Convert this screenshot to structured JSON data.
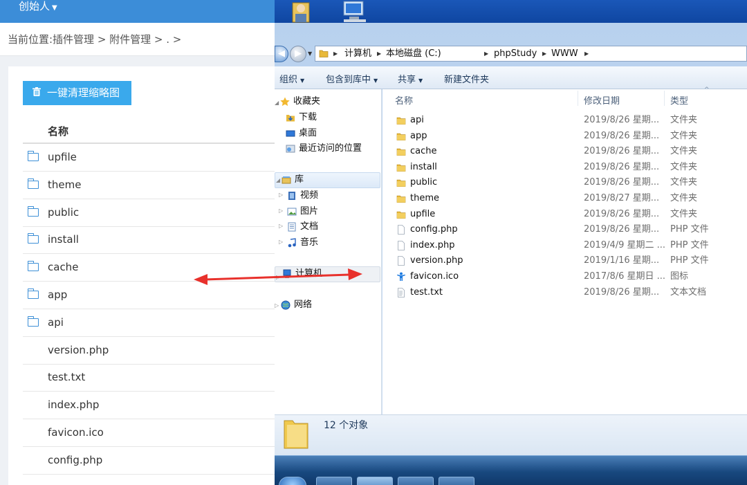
{
  "web": {
    "user_menu": "创始人",
    "breadcrumb": "当前位置:插件管理 > 附件管理 > . >",
    "clean_button": "一键清理缩略图",
    "table_header": "名称",
    "files": [
      "upfile",
      "theme",
      "public",
      "install",
      "cache",
      "app",
      "api",
      "version.php",
      "test.txt",
      "index.php",
      "favicon.ico",
      "config.php"
    ]
  },
  "explorer": {
    "address": [
      "计算机",
      "本地磁盘 (C:)",
      "phpStudy",
      "WWW"
    ],
    "toolbar": [
      "组织",
      "包含到库中",
      "共享",
      "新建文件夹"
    ],
    "nav": {
      "favorites": "收藏夹",
      "downloads": "下载",
      "desktop": "桌面",
      "recent": "最近访问的位置",
      "libraries": "库",
      "videos": "视频",
      "pictures": "图片",
      "documents": "文档",
      "music": "音乐",
      "computer": "计算机",
      "network": "网络"
    },
    "columns": {
      "name": "名称",
      "date": "修改日期",
      "type": "类型"
    },
    "rows": [
      {
        "name": "api",
        "date": "2019/8/26 星期...",
        "type": "文件夹",
        "kind": "folder"
      },
      {
        "name": "app",
        "date": "2019/8/26 星期...",
        "type": "文件夹",
        "kind": "folder"
      },
      {
        "name": "cache",
        "date": "2019/8/26 星期...",
        "type": "文件夹",
        "kind": "folder"
      },
      {
        "name": "install",
        "date": "2019/8/26 星期...",
        "type": "文件夹",
        "kind": "folder"
      },
      {
        "name": "public",
        "date": "2019/8/26 星期...",
        "type": "文件夹",
        "kind": "folder"
      },
      {
        "name": "theme",
        "date": "2019/8/27 星期...",
        "type": "文件夹",
        "kind": "folder"
      },
      {
        "name": "upfile",
        "date": "2019/8/26 星期...",
        "type": "文件夹",
        "kind": "folder"
      },
      {
        "name": "config.php",
        "date": "2019/8/26 星期...",
        "type": "PHP 文件",
        "kind": "file"
      },
      {
        "name": "index.php",
        "date": "2019/4/9 星期二 ...",
        "type": "PHP 文件",
        "kind": "file"
      },
      {
        "name": "version.php",
        "date": "2019/1/16 星期...",
        "type": "PHP 文件",
        "kind": "file"
      },
      {
        "name": "favicon.ico",
        "date": "2017/8/6 星期日 ...",
        "type": "图标",
        "kind": "ico"
      },
      {
        "name": "test.txt",
        "date": "2019/8/26 星期...",
        "type": "文本文档",
        "kind": "txt"
      }
    ],
    "status": "12 个对象"
  },
  "colors": {
    "web_header": "#3c8dd8",
    "button": "#3aa9ec",
    "folder": "#e8b93a",
    "arrow": "#e8312c"
  }
}
